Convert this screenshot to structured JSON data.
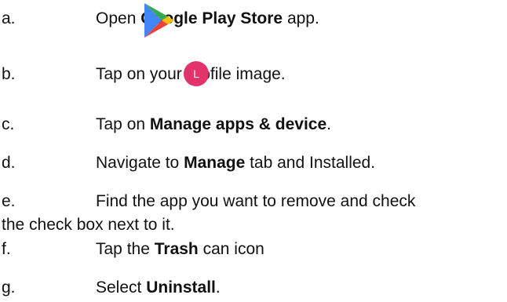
{
  "steps": [
    {
      "letter": "a.",
      "parts": [
        "Open ",
        "Google Play Store",
        " app."
      ]
    },
    {
      "letter": "b.",
      "parts": [
        "Tap on your profile image."
      ]
    },
    {
      "letter": "c.",
      "parts": [
        "Tap on ",
        "Manage apps & device",
        "."
      ]
    },
    {
      "letter": "d.",
      "parts": [
        "Navigate to ",
        "Manage",
        " tab and Installed."
      ]
    },
    {
      "letter": "e.",
      "parts": [
        "Find the app you want to remove and check"
      ],
      "continuation": "the check box next to it."
    },
    {
      "letter": "f.",
      "parts": [
        "Tap the ",
        "Trash",
        " can icon"
      ]
    },
    {
      "letter": "g.",
      "parts": [
        "Select ",
        "Uninstall",
        "."
      ]
    }
  ],
  "icons": {
    "play_store": "google-play-store-icon",
    "avatar": "profile-avatar-icon"
  },
  "avatar_initial": "L",
  "colors": {
    "avatar_bg": "#e3336b",
    "play_blue": "#4285f4",
    "play_green": "#34a853",
    "play_yellow": "#fbbc04",
    "play_red": "#ea4335"
  }
}
